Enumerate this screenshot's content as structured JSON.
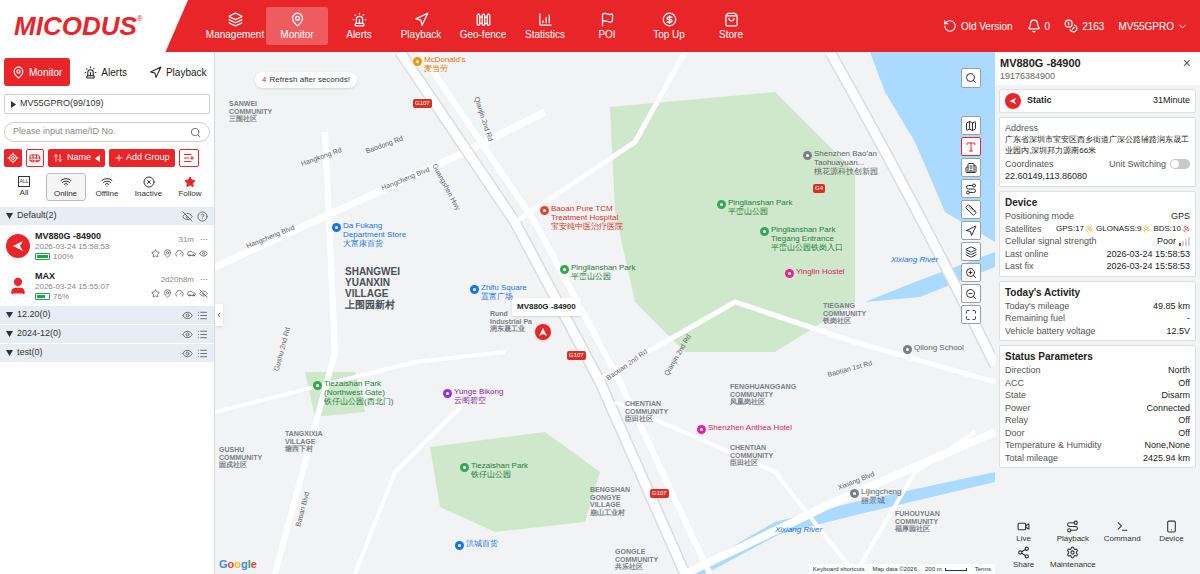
{
  "header": {
    "logo": "MICODUS",
    "logo_mark": "®",
    "nav": [
      {
        "label": "Management",
        "selected": false
      },
      {
        "label": "Monitor",
        "selected": true
      },
      {
        "label": "Alerts",
        "selected": false
      },
      {
        "label": "Playback",
        "selected": false
      },
      {
        "label": "Geo-fence",
        "selected": false
      },
      {
        "label": "Statistics",
        "selected": false
      },
      {
        "label": "POI",
        "selected": false
      },
      {
        "label": "Top Up",
        "selected": false
      },
      {
        "label": "Store",
        "selected": false
      }
    ],
    "old_version": "Old Version",
    "notifications": "0",
    "coins": "2163",
    "account": "MV55GPRO"
  },
  "sidebar": {
    "tabs": [
      {
        "label": "Monitor",
        "selected": true
      },
      {
        "label": "Alerts",
        "selected": false
      },
      {
        "label": "Playback",
        "selected": false
      }
    ],
    "account": "MV55GPRO(99/109)",
    "search_placeholder": "Please input name/ID No.",
    "sort_label": "Name",
    "add_group": "Add Group",
    "all_icon_text": "ALL",
    "menu_glyph": "···",
    "filters": [
      {
        "label": "All",
        "selected": false
      },
      {
        "label": "Online",
        "selected": true
      },
      {
        "label": "Offline",
        "selected": false
      },
      {
        "label": "Inactive",
        "selected": false
      },
      {
        "label": "Follow",
        "selected": false
      }
    ],
    "groups": [
      {
        "name": "Default(2)",
        "expanded": true,
        "visible": false,
        "devices": [
          {
            "name": "MV880G -84900",
            "ago": "31m",
            "time": "2026-03-24 15:58:53",
            "battery": "100%",
            "level": 1,
            "kind": "vehicle",
            "visible": true
          },
          {
            "name": "MAX",
            "ago": "2d20h8m",
            "time": "2026-03-24 15:55:07",
            "battery": "76%",
            "level": 0.76,
            "kind": "person",
            "visible": false
          }
        ]
      },
      {
        "name": "12.20(0)",
        "expanded": false,
        "visible": true,
        "devices": []
      },
      {
        "name": "2024-12(0)",
        "expanded": false,
        "visible": true,
        "devices": []
      },
      {
        "name": "test(0)",
        "expanded": false,
        "visible": true,
        "devices": []
      }
    ]
  },
  "map": {
    "refresh": {
      "count": "4",
      "text": "Refresh after seconds!"
    },
    "marker": {
      "label": "MV880G -84900"
    },
    "labels": [
      {
        "kind": "poi_food",
        "lines": [
          "McDonald's",
          "麦当劳"
        ]
      },
      {
        "kind": "area",
        "lines": [
          "SANWEI",
          "COMMUNITY",
          "三围社区"
        ]
      },
      {
        "kind": "district",
        "lines": [
          "SHANGWEI",
          "YUANXIN",
          "VILLAGE",
          "上围园新村"
        ]
      },
      {
        "kind": "poi_shop",
        "lines": [
          "Da Fukang",
          "Department Store",
          "大富康百货"
        ]
      },
      {
        "kind": "poi_hospital",
        "lines": [
          "Baoan Pure TCM",
          "Treatment Hospital",
          "宝安纯中医治疗医院"
        ]
      },
      {
        "kind": "park",
        "lines": [
          "Pinglianshan Park",
          "平峦山公园"
        ]
      },
      {
        "kind": "poi_shop",
        "lines": [
          "Zhifu Square",
          "置富广场"
        ]
      },
      {
        "kind": "area",
        "lines": [
          "Rund",
          "Industrial Pa",
          "润东晟工业"
        ]
      },
      {
        "kind": "park",
        "lines": [
          "Tiezaishan Park",
          "(Northwest Gate)",
          "铁仔山公园(西北门)"
        ]
      },
      {
        "kind": "poi_purple",
        "lines": [
          "Yunge Bikong",
          "云阁碧空"
        ]
      },
      {
        "kind": "park",
        "lines": [
          "Tiezaishan Park",
          "铁仔山公园"
        ]
      },
      {
        "kind": "area",
        "lines": [
          "TANGXIXIA",
          "VILLAGE",
          "塘西下村"
        ]
      },
      {
        "kind": "area",
        "lines": [
          "GUSHU",
          "COMMUNITY",
          "固戍社区"
        ]
      },
      {
        "kind": "poi_shop",
        "lines": [
          "洪城百货"
        ]
      },
      {
        "kind": "area",
        "lines": [
          "BENGSHAN",
          "GONGYE",
          "VILLAGE",
          "崩山工业村"
        ]
      },
      {
        "kind": "area",
        "lines": [
          "CHENTIAN",
          "COMMUNITY",
          "臣田社区"
        ]
      },
      {
        "kind": "park",
        "lines": [
          "Pinglianshan Park",
          "平峦山公园"
        ]
      },
      {
        "kind": "park",
        "lines": [
          "Pinglianshan Park",
          "Tiegang Entrance",
          "平峦山公园铁岗入口"
        ]
      },
      {
        "kind": "poi_grey",
        "lines": [
          "Shenzhen Bao'an",
          "Taohuayuan...",
          "桃花源科技创新园"
        ]
      },
      {
        "kind": "poi_pink",
        "lines": [
          "Yinglin Hostel"
        ]
      },
      {
        "kind": "area",
        "lines": [
          "TIEGANG",
          "COMMUNITY",
          "铁岗社区"
        ]
      },
      {
        "kind": "poi_grey",
        "lines": [
          "Qilong School"
        ]
      },
      {
        "kind": "area",
        "lines": [
          "FENGHUANGGANG",
          "COMMUNITY",
          "凤凰岗社区"
        ]
      },
      {
        "kind": "poi_pink",
        "lines": [
          "Shenzhen Anthea Hotel"
        ]
      },
      {
        "kind": "area",
        "lines": [
          "CHENTIAN",
          "COMMUNITY",
          "臣田社区"
        ]
      },
      {
        "kind": "poi_grey",
        "lines": [
          "Lijingcheng",
          "丽景城"
        ]
      },
      {
        "kind": "area",
        "lines": [
          "FUHOUYUAN",
          "COMMUNITY",
          "福厚园社区"
        ]
      },
      {
        "kind": "area",
        "lines": [
          "GONGLE",
          "COMMUNITY",
          "共乐社区"
        ]
      },
      {
        "kind": "water",
        "lines": [
          "Xixiang River"
        ]
      },
      {
        "kind": "water",
        "lines": [
          "Xixiang River"
        ]
      }
    ],
    "roads": [
      "Hangcheng Blvd",
      "Hangcheng Blvd",
      "Hangkong Rd",
      "Baodong Rd",
      "Guangshen Hwy",
      "Qianjin 2nd Rd",
      "Qianjin 2nd Rd",
      "Baotian 2nd Rd",
      "Baotian 1st Rd",
      "Xixiang Blvd",
      "Baoan Blvd",
      "Gushu 2nd Rd"
    ],
    "road_badges": [
      "G107",
      "G107",
      "G107",
      "G4"
    ],
    "attribution": {
      "google": "Google",
      "shortcuts": "Keyboard shortcuts",
      "data": "Map data ©2026",
      "scale": "200 m",
      "terms": "Terms"
    }
  },
  "detail": {
    "name": "MV880G -84900",
    "phone": "19176384900",
    "close": "×",
    "status": {
      "label": "Static",
      "duration": "31Minute"
    },
    "address_label": "Address",
    "address": "广东省深圳市宝安区西乡街道广深公路辅路润东晟工业园内,深圳邦力源南66米",
    "coordinates_label": "Coordinates",
    "unit_switching": {
      "label": "Unit Switching",
      "on": false
    },
    "coordinates": "22.60149,113.86080",
    "sections": [
      {
        "title": "Device",
        "rows": [
          {
            "kind": "text",
            "label": "Positioning mode",
            "value": "GPS"
          },
          {
            "kind": "satellites",
            "label": "Satellites",
            "values": [
              {
                "text": "GPS:17",
                "color": "#f59e0b"
              },
              {
                "text": "GLONASS:9",
                "color": "#f59e0b"
              },
              {
                "text": "BDS:10",
                "color": "#dc2626"
              }
            ]
          },
          {
            "kind": "signal",
            "label": "Cellular signal strength",
            "value": "Poor",
            "level": 0.25
          },
          {
            "kind": "text",
            "label": "Last online",
            "value": "2026-03-24 15:58:53"
          },
          {
            "kind": "text",
            "label": "Last fix",
            "value": "2026-03-24 15:58:53"
          }
        ]
      },
      {
        "title": "Today's Activity",
        "rows": [
          {
            "kind": "text",
            "label": "Today's mileage",
            "value": "49.85 km"
          },
          {
            "kind": "text",
            "label": "Remaining fuel",
            "value": "-"
          },
          {
            "kind": "text",
            "label": "Vehicle battery voltage",
            "value": "12.5V"
          }
        ]
      },
      {
        "title": "Status Parameters",
        "rows": [
          {
            "kind": "text",
            "label": "Direction",
            "value": "North"
          },
          {
            "kind": "text",
            "label": "ACC",
            "value": "Off"
          },
          {
            "kind": "text",
            "label": "State",
            "value": "Disarm"
          },
          {
            "kind": "text",
            "label": "Power",
            "value": "Connected"
          },
          {
            "kind": "text",
            "label": "Relay",
            "value": "Off"
          },
          {
            "kind": "text",
            "label": "Door",
            "value": "Off"
          },
          {
            "kind": "text",
            "label": "Temperature & Humidity",
            "value": "None,None"
          },
          {
            "kind": "text",
            "label": "Total mileage",
            "value": "2425.94 km"
          }
        ]
      }
    ],
    "actions": [
      "Live",
      "Playback",
      "Command",
      "Device",
      "Share",
      "Maintenance"
    ]
  }
}
